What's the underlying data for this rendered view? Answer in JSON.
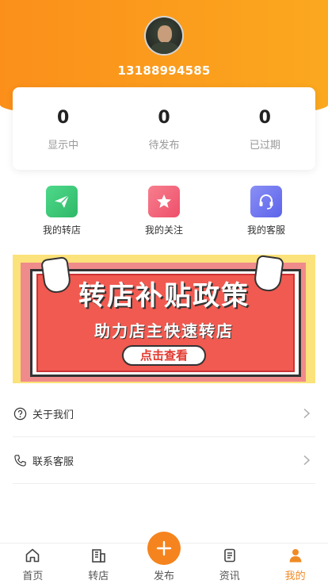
{
  "profile": {
    "phone": "13188994585",
    "avatar_icon": "user-avatar"
  },
  "stats": [
    {
      "value": "0",
      "label": "显示中"
    },
    {
      "value": "0",
      "label": "待发布"
    },
    {
      "value": "0",
      "label": "已过期"
    }
  ],
  "quick_actions": [
    {
      "label": "我的转店",
      "icon": "paper-plane-icon",
      "color": "#3cc87a"
    },
    {
      "label": "我的关注",
      "icon": "star-icon",
      "color": "#f2627a"
    },
    {
      "label": "我的客服",
      "icon": "headset-icon",
      "color": "#6b74f0"
    }
  ],
  "banner": {
    "title": "转店补贴政策",
    "subtitle": "助力店主快速转店",
    "cta": "点击查看"
  },
  "menu": [
    {
      "label": "关于我们",
      "icon": "question-circle-icon"
    },
    {
      "label": "联系客服",
      "icon": "phone-icon"
    }
  ],
  "tabbar": [
    {
      "label": "首页",
      "icon": "home-icon"
    },
    {
      "label": "转店",
      "icon": "building-icon"
    },
    {
      "label": "发布",
      "icon": "plus-icon"
    },
    {
      "label": "资讯",
      "icon": "news-icon"
    },
    {
      "label": "我的",
      "icon": "user-icon",
      "active": true
    }
  ],
  "colors": {
    "brand": "#fb8f1a",
    "accent": "#f5841f"
  }
}
